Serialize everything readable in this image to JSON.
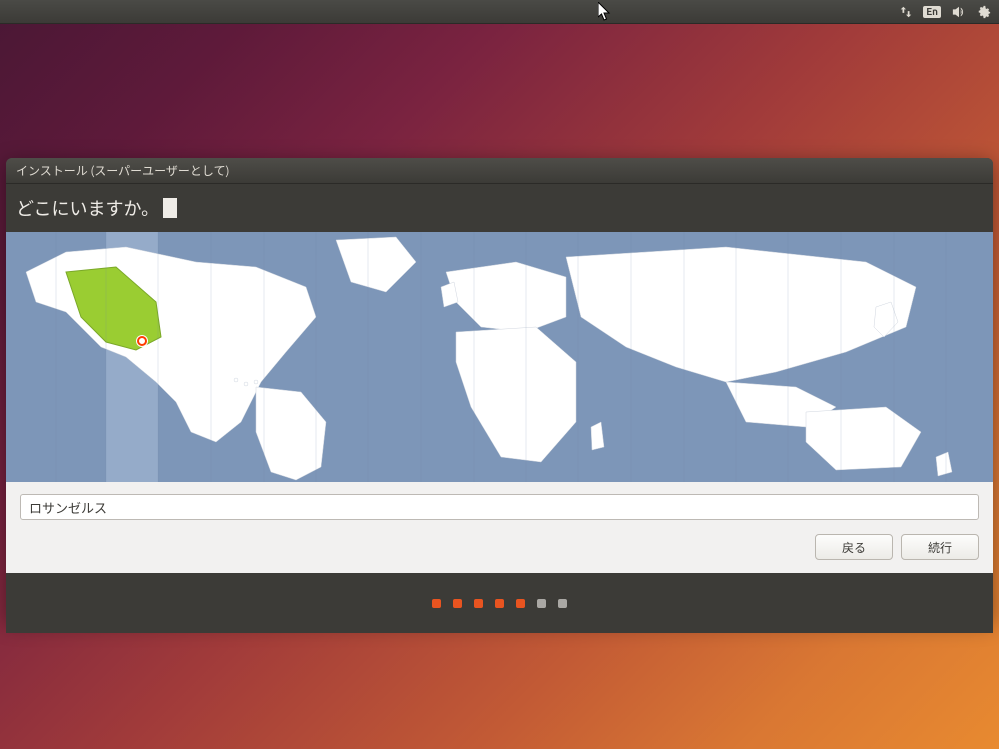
{
  "menubar": {
    "language_indicator": "En"
  },
  "installer": {
    "window_title": "インストール (スーパーユーザーとして)",
    "heading": "どこにいますか。",
    "location_value": "ロサンゼルス",
    "back_label": "戻る",
    "continue_label": "続行"
  },
  "progress": {
    "total": 7,
    "current": 5
  }
}
